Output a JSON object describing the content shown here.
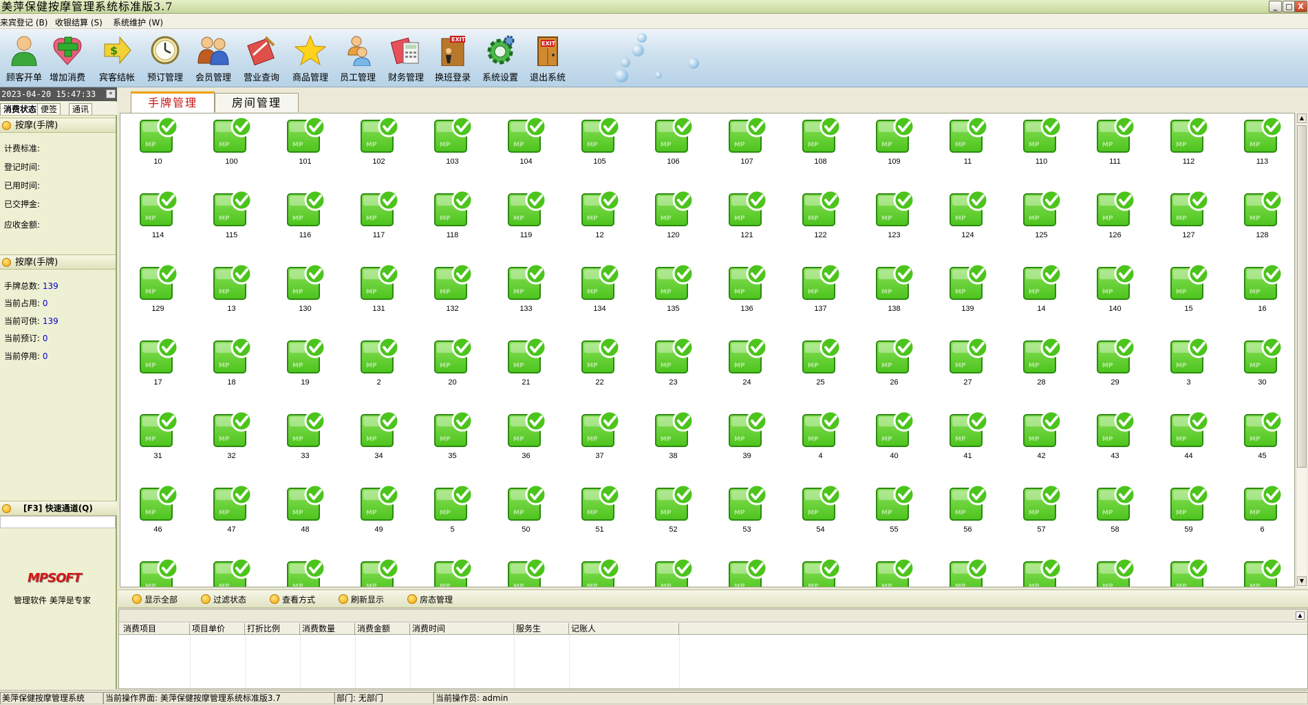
{
  "window": {
    "title": "美萍保健按摩管理系统标准版3.7",
    "controls": [
      "_",
      "□",
      "X"
    ]
  },
  "menu": [
    "来宾登记 (B)",
    "收银结算 (S)",
    "系统维护 (W)"
  ],
  "toolbar": [
    {
      "label": "顾客开单",
      "icon": "customer-icon"
    },
    {
      "label": "增加消费",
      "icon": "add-consumption-icon"
    },
    {
      "label": "宾客结帐",
      "icon": "checkout-icon"
    },
    {
      "label": "预订管理",
      "icon": "clock-icon"
    },
    {
      "label": "会员管理",
      "icon": "members-icon"
    },
    {
      "label": "营业查询",
      "icon": "query-icon"
    },
    {
      "label": "商品管理",
      "icon": "star-icon"
    },
    {
      "label": "员工管理",
      "icon": "staff-icon"
    },
    {
      "label": "财务管理",
      "icon": "finance-icon"
    },
    {
      "label": "换班登录",
      "icon": "shift-exit-icon"
    },
    {
      "label": "系统设置",
      "icon": "gear-icon"
    },
    {
      "label": "退出系统",
      "icon": "exit-door-icon"
    }
  ],
  "left_panel": {
    "datetime": "2023-04-20 15:47:33",
    "collapse_glyph": "«",
    "tabs": [
      "消费状态",
      "便签",
      "通讯"
    ],
    "section1": {
      "title": "按摩(手牌)",
      "fields": [
        {
          "label": "计费标准:",
          "value": ""
        },
        {
          "label": "登记时间:",
          "value": ""
        },
        {
          "label": "已用时间:",
          "value": ""
        },
        {
          "label": "已交押金:",
          "value": ""
        },
        {
          "label": "应收金额:",
          "value": ""
        }
      ]
    },
    "section2": {
      "title": "按摩(手牌)",
      "fields": [
        {
          "label": "手牌总数:",
          "value": "139"
        },
        {
          "label": "当前占用:",
          "value": "0"
        },
        {
          "label": "当前可供:",
          "value": "139"
        },
        {
          "label": "当前预订:",
          "value": "0"
        },
        {
          "label": "当前停用:",
          "value": "0"
        }
      ]
    },
    "quick_channel": "[F3] 快速通道(Q)",
    "logo": "MPSOFT",
    "slogan": "管理软件 美萍是专家"
  },
  "main_tabs": [
    "手牌管理",
    "房间管理"
  ],
  "tiles": [
    "10",
    "100",
    "101",
    "102",
    "103",
    "104",
    "105",
    "106",
    "107",
    "108",
    "109",
    "11",
    "110",
    "111",
    "112",
    "113",
    "114",
    "115",
    "116",
    "117",
    "118",
    "119",
    "12",
    "120",
    "121",
    "122",
    "123",
    "124",
    "125",
    "126",
    "127",
    "128",
    "129",
    "13",
    "130",
    "131",
    "132",
    "133",
    "134",
    "135",
    "136",
    "137",
    "138",
    "139",
    "14",
    "140",
    "15",
    "16",
    "17",
    "18",
    "19",
    "2",
    "20",
    "21",
    "22",
    "23",
    "24",
    "25",
    "26",
    "27",
    "28",
    "29",
    "3",
    "30",
    "31",
    "32",
    "33",
    "34",
    "35",
    "36",
    "37",
    "38",
    "39",
    "4",
    "40",
    "41",
    "42",
    "43",
    "44",
    "45",
    "46",
    "47",
    "48",
    "49",
    "5",
    "50",
    "51",
    "52",
    "53",
    "54",
    "55",
    "56",
    "57",
    "58",
    "59",
    "6",
    "",
    "",
    "",
    "",
    "",
    "",
    "",
    "",
    "",
    "",
    "",
    "",
    "",
    "",
    "",
    ""
  ],
  "tile_icon_text": "MP",
  "grid_footer": [
    "显示全部",
    "过滤状态",
    "查看方式",
    "刷新显示",
    "房态管理"
  ],
  "detail_columns": [
    "消费项目",
    "项目单价",
    "打折比例",
    "消费数量",
    "消费金额",
    "消费时间",
    "服务生",
    "记账人"
  ],
  "statusbar": {
    "app": "美萍保健按摩管理系统",
    "current_screen": "当前操作界面: 美萍保健按摩管理系统标准版3.7",
    "department": "部门: 无部门",
    "operator": "当前操作员: admin"
  },
  "colors": {
    "tile_green": "#4cc41c",
    "tile_dark": "#2a8a10",
    "accent_orange": "#f0a000",
    "active_tab_red": "#c81414"
  }
}
